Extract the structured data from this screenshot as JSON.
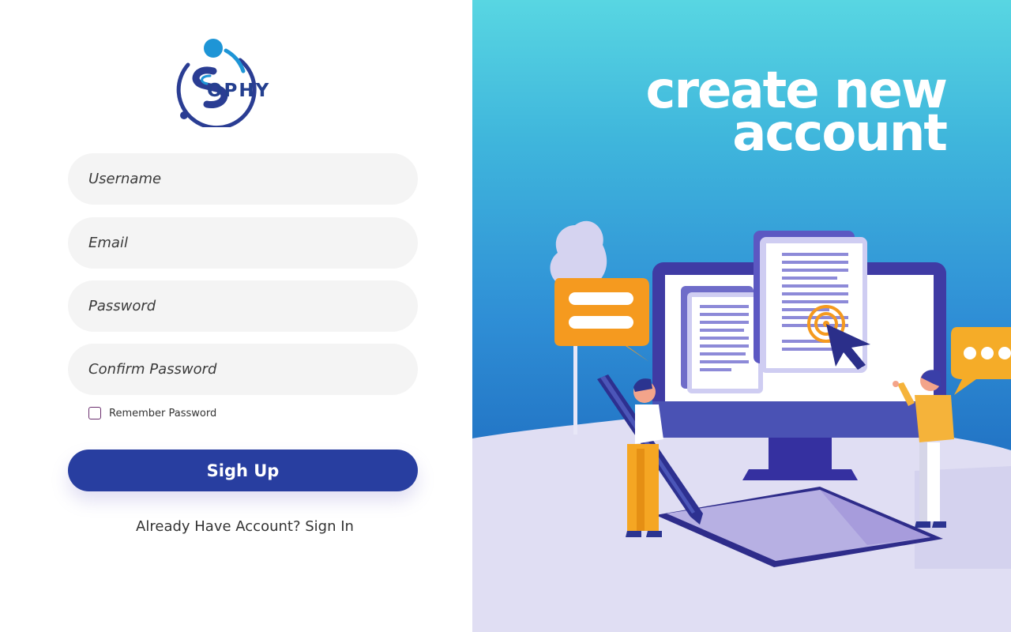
{
  "brand": {
    "name": "OPHY",
    "logo_letter": "S"
  },
  "form": {
    "username_placeholder": "Username",
    "email_placeholder": "Email",
    "password_placeholder": "Password",
    "confirm_password_placeholder": "Confirm Password",
    "remember_label": "Remember Password",
    "submit_label": "Sigh Up",
    "signin_link": "Already Have Account? Sign In"
  },
  "hero": {
    "headline_line1": "create new",
    "headline_line2": "account"
  },
  "colors": {
    "primary": "#283ea0",
    "accent_orange": "#f59a1f",
    "input_bg": "#f4f4f4",
    "hero_gradient_top": "#58d6e2",
    "hero_gradient_bottom": "#2274c4"
  },
  "icons": [
    "brand-logo-icon",
    "checkbox-icon",
    "chat-bubble-icon",
    "typing-bubble-icon",
    "cursor-icon",
    "document-icon",
    "monitor-icon",
    "pen-icon"
  ]
}
